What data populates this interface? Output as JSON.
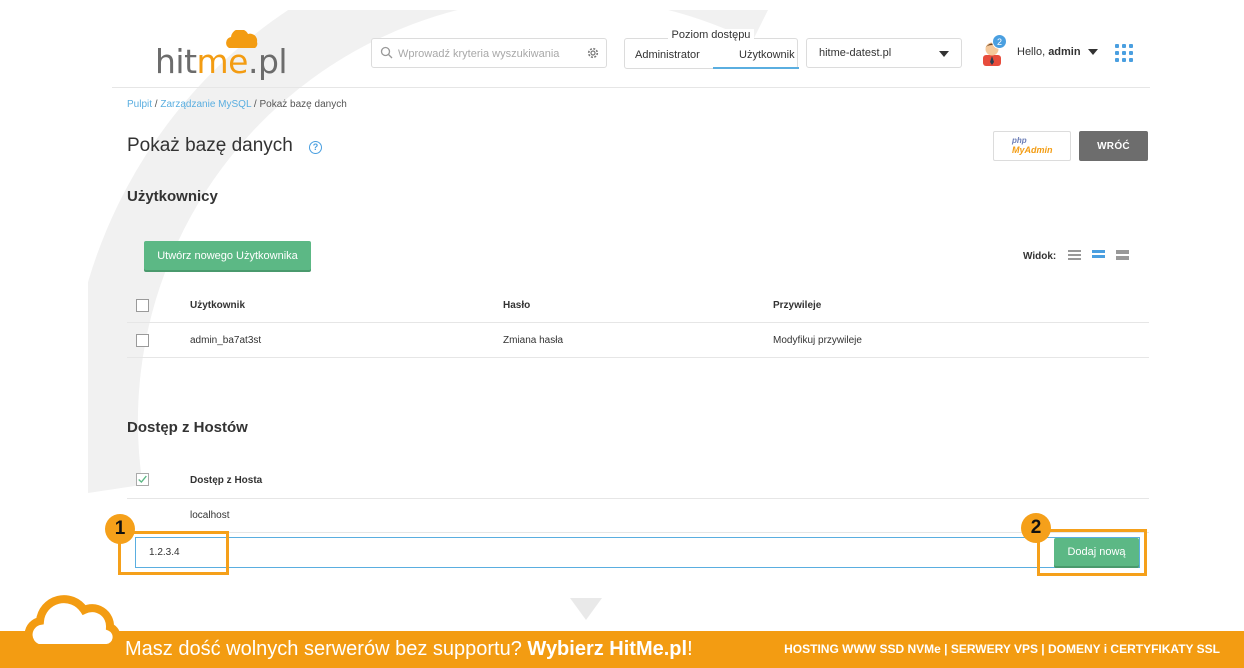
{
  "header": {
    "logo": {
      "prefix": "hit",
      "highlight": "me",
      "suffix": ".pl"
    },
    "search_placeholder": "Wprowadź kryteria wyszukiwania",
    "access": {
      "label": "Poziom dostępu",
      "options": [
        "Administrator",
        "Użytkownik"
      ],
      "selected": "Użytkownik"
    },
    "domain": "hitme-datest.pl",
    "notifications": "2",
    "greeting_prefix": "Hello,",
    "username": "admin"
  },
  "breadcrumb": {
    "items": [
      "Pulpit",
      "Zarządzanie MySQL",
      "Pokaż bazę danych"
    ],
    "separator": "/"
  },
  "page": {
    "title": "Pokaż bazę danych",
    "help": "?",
    "pma": {
      "php": "php",
      "my": "MyAdmin"
    },
    "back": "WRÓĆ"
  },
  "users": {
    "title": "Użytkownicy",
    "create_button": "Utwórz nowego Użytkownika",
    "view_label": "Widok:",
    "columns": [
      "Użytkownik",
      "Hasło",
      "Przywileje"
    ],
    "rows": [
      {
        "user": "admin_ba7at3st",
        "password": "Zmiana hasła",
        "privileges": "Modyfikuj przywileje"
      }
    ]
  },
  "hosts": {
    "title": "Dostęp z Hostów",
    "column": "Dostęp z Hosta",
    "rows": [
      "localhost"
    ],
    "input_value": "1.2.3.4",
    "add_button": "Dodaj nową"
  },
  "markers": [
    "1",
    "2"
  ],
  "banner": {
    "text": "Masz dość wolnych serwerów bez supportu?",
    "bold": "Wybierz HitMe.pl",
    "exclaim": "!",
    "right": "HOSTING WWW SSD NVMe | SERWERY VPS | DOMENY i CERTYFIKATY SSL"
  },
  "colors": {
    "accent_orange": "#f39c12",
    "green": "#5cb885",
    "blue": "#5aaee0",
    "back_gray": "#6d6d6d"
  }
}
